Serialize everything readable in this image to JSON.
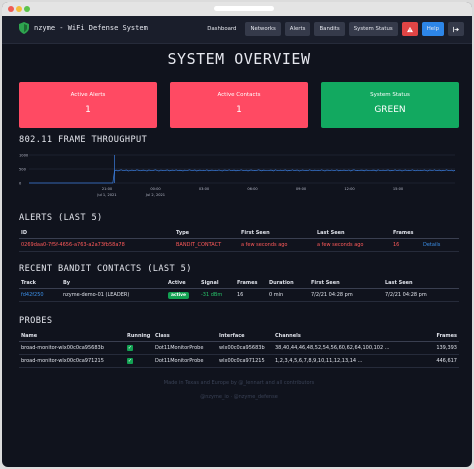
{
  "app": {
    "brand": "nzyme - WiFi Defense System"
  },
  "nav": {
    "items": [
      "Dashboard",
      "Networks",
      "Alerts",
      "Bandits",
      "System Status"
    ],
    "help": "Help"
  },
  "overview": {
    "title": "SYSTEM OVERVIEW",
    "cards": [
      {
        "label": "Active Alerts",
        "value": "1",
        "color": "#ff4a63"
      },
      {
        "label": "Active Contacts",
        "value": "1",
        "color": "#ff4a63"
      },
      {
        "label": "System Status",
        "value": "GREEN",
        "color": "#12a960"
      }
    ]
  },
  "throughput": {
    "title": "802.11 FRAME THROUGHPUT",
    "chart_data": {
      "type": "line",
      "y_ticks": [
        "1000",
        "500",
        "0"
      ],
      "ylim": [
        0,
        1000
      ],
      "x_ticks": [
        "21:00",
        "00:00",
        "03:00",
        "06:00",
        "09:00",
        "12:00",
        "15:00"
      ],
      "x_date_labels": [
        "Jul 1, 2021",
        "Jul 2, 2021"
      ],
      "series": [
        {
          "color": "#3b7ddd",
          "values": [
            0,
            0,
            0,
            0,
            0,
            0,
            0,
            0,
            0,
            0,
            0,
            0,
            0,
            0,
            0,
            0,
            0,
            0,
            0,
            0,
            0,
            0,
            0,
            0,
            0,
            0,
            0,
            0,
            0,
            0,
            0,
            0,
            0,
            0,
            0,
            0,
            0,
            0,
            0,
            0,
            0,
            0,
            0,
            0,
            0,
            0,
            0,
            0,
            0,
            0,
            440,
            460,
            430,
            455,
            470,
            440,
            450,
            465,
            430,
            445,
            460,
            450,
            440,
            470,
            455,
            435,
            450,
            460,
            445,
            430,
            465,
            450,
            440,
            455,
            470,
            445,
            430,
            460,
            450,
            440,
            455,
            465,
            435,
            450,
            460,
            445,
            470,
            440,
            455,
            450,
            430,
            460,
            445,
            455,
            470,
            440,
            450,
            465,
            430,
            450,
            460,
            440,
            455,
            445,
            470,
            435,
            450,
            460,
            445,
            455,
            440,
            465,
            450,
            430,
            460,
            455,
            445,
            470,
            440,
            450,
            460,
            435,
            455,
            445,
            470,
            450,
            440,
            460,
            430,
            455,
            465,
            445,
            450,
            440,
            470,
            455,
            435,
            460,
            450,
            445,
            440,
            460,
            455,
            430,
            470,
            450,
            445,
            460,
            440,
            455,
            465,
            435,
            450,
            445,
            470,
            440,
            455,
            460,
            430,
            450,
            465,
            445,
            455,
            440,
            470,
            450,
            435,
            460,
            445,
            455,
            440,
            470,
            450,
            430,
            460,
            455,
            445,
            465,
            440,
            450,
            470,
            435,
            455,
            445,
            460,
            450,
            440,
            465,
            430,
            455,
            470,
            445,
            450,
            440,
            460,
            455,
            435,
            465,
            450,
            445,
            440,
            460,
            455,
            430,
            470,
            450,
            445,
            460,
            440,
            455,
            465,
            435,
            450,
            445,
            470,
            440,
            455,
            460,
            430,
            450,
            465,
            445,
            455,
            440,
            470,
            450,
            435,
            460,
            445,
            455,
            440,
            465,
            450,
            430,
            460,
            455,
            445,
            470,
            440,
            450,
            460,
            435,
            455,
            445,
            470,
            450,
            440,
            460,
            430,
            455
          ]
        }
      ]
    }
  },
  "alerts": {
    "title": "ALERTS (LAST 5)",
    "columns": [
      "ID",
      "Type",
      "First Seen",
      "Last Seen",
      "Frames"
    ],
    "rows": [
      {
        "id": "0269daa0-7f5f-4656-a763-a2a73fb58a78",
        "type": "BANDIT_CONTACT",
        "first_seen": "a few seconds ago",
        "last_seen": "a few seconds ago",
        "frames": "16",
        "action": "Details"
      }
    ]
  },
  "bandits": {
    "title": "RECENT BANDIT CONTACTS (LAST 5)",
    "columns": [
      "Track",
      "By",
      "Active",
      "Signal",
      "Frames",
      "Duration",
      "First Seen",
      "Last Seen"
    ],
    "rows": [
      {
        "track": "fd42f250",
        "by": "nzyme-demo-01 (LEADER)",
        "active": "active",
        "signal": "-31 dBm",
        "frames": "16",
        "duration": "0 min",
        "first_seen": "7/2/21 04:28 pm",
        "last_seen": "7/2/21 04:28 pm"
      }
    ]
  },
  "probes": {
    "title": "PROBES",
    "columns": [
      "Name",
      "Running",
      "Class",
      "Interface",
      "Channels",
      "Frames"
    ],
    "rows": [
      {
        "name": "broad-monitor-wlx00c0ca95683b",
        "class": "Dot11MonitorProbe",
        "interface": "wlx00c0ca95683b",
        "channels": "38,40,44,46,48,52,54,56,60,62,64,100,102 ...",
        "frames": "139,393"
      },
      {
        "name": "broad-monitor-wlx00c0ca971215",
        "class": "Dot11MonitorProbe",
        "interface": "wlx00c0ca971215",
        "channels": "1,2,3,4,5,6,7,8,9,10,11,12,13,14 ...",
        "frames": "446,617"
      }
    ]
  },
  "footer": {
    "line1": "Made in Texas and Europe by @_lennart and all contributors",
    "line2": "@nzyme_io · @nzyme_defense"
  },
  "colors": {
    "accent": "#2d86e8",
    "danger": "#e04545",
    "success": "#12a152"
  }
}
